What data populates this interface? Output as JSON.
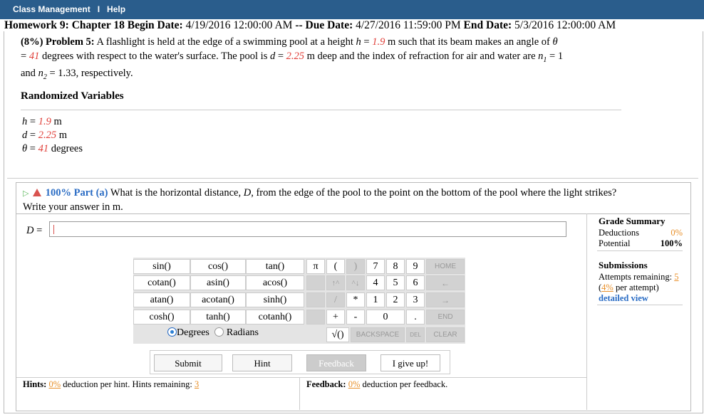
{
  "nav": {
    "class_management": "Class Management",
    "separator": "I",
    "help": "Help"
  },
  "homework": {
    "title": "Homework 9: Chapter 18",
    "begin_label": "Begin Date:",
    "begin": "4/19/2016 12:00:00 AM",
    "due_sep": "--",
    "due_label": "Due Date:",
    "due": "4/27/2016 11:59:00 PM",
    "end_label": "End Date:",
    "end": "5/3/2016 12:00:00 AM"
  },
  "problem": {
    "header": "(8%) Problem 5:",
    "t1": " A flashlight is held at the edge of a swimming pool at a height ",
    "h_sym": "h",
    "eq": " = ",
    "h_val": "1.9",
    "t2": " m such that its beam makes an angle of ",
    "theta_sym": "θ",
    "t3": "= ",
    "theta_val": "41",
    "t4": " degrees with respect to the water's surface. The pool is ",
    "d_sym": "d",
    "d_val": "2.25",
    "t5": " m deep and the index of refraction for air and water are ",
    "n1_sym": "n",
    "n1_sub": "1",
    "n1_val": " = 1",
    "t6": "and ",
    "n2_sym": "n",
    "n2_sub": "2",
    "n2_val": " = 1.33, respectively."
  },
  "randomized": {
    "title": "Randomized Variables",
    "vars": [
      {
        "sym": "h",
        "eq": " = ",
        "val": "1.9",
        "unit": " m"
      },
      {
        "sym": "d",
        "eq": " = ",
        "val": "2.25",
        "unit": " m"
      },
      {
        "sym": "θ",
        "eq": " = ",
        "val": "41",
        "unit": " degrees"
      }
    ]
  },
  "part": {
    "percent": "100% Part (a)",
    "question": " What is the horizontal distance, ",
    "D": "D",
    "question2": ", from the edge of the pool to the point on the bottom of the pool where the light strikes?",
    "line2": "Write your answer in m."
  },
  "answer": {
    "label": "D = ",
    "value": ""
  },
  "grade_summary": {
    "title": "Grade Summary",
    "deductions_label": "Deductions",
    "deductions": "0%",
    "potential_label": "Potential",
    "potential": "100%"
  },
  "submissions": {
    "title": "Submissions",
    "attempts_label": "Attempts remaining: ",
    "attempts": "5",
    "per_pct": "4%",
    "per_label": " per attempt)",
    "open_paren": "(",
    "detailed": "detailed view"
  },
  "keypad": {
    "funcs": [
      "sin()",
      "cos()",
      "tan()",
      "cotan()",
      "asin()",
      "acos()",
      "atan()",
      "acotan()",
      "sinh()",
      "cosh()",
      "tanh()",
      "cotanh()"
    ],
    "pi": "π",
    "lparen": "(",
    "rparen": ")",
    "up": "↑^",
    "down": "^↓",
    "slash": "/",
    "star": "*",
    "plus": "+",
    "minus": "-",
    "digits": [
      "7",
      "8",
      "9",
      "4",
      "5",
      "6",
      "1",
      "2",
      "3",
      "0"
    ],
    "dot": ".",
    "sqrt": "√()",
    "home": "HOME",
    "left": "←",
    "right": "→",
    "end": "END",
    "backspace": "BACKSPACE",
    "del": "DEL",
    "clear": "CLEAR"
  },
  "angle_mode": {
    "degrees": "Degrees",
    "radians": "Radians",
    "selected": "Degrees"
  },
  "buttons": {
    "submit": "Submit",
    "hint": "Hint",
    "feedback": "Feedback",
    "give_up": "I give up!"
  },
  "footer": {
    "hints_label": "Hints:",
    "hints_pct": "0%",
    "hints_text": " deduction per hint. Hints remaining: ",
    "hints_remaining": "3",
    "feedback_label": "Feedback:",
    "feedback_pct": "0%",
    "feedback_text": " deduction per feedback."
  }
}
